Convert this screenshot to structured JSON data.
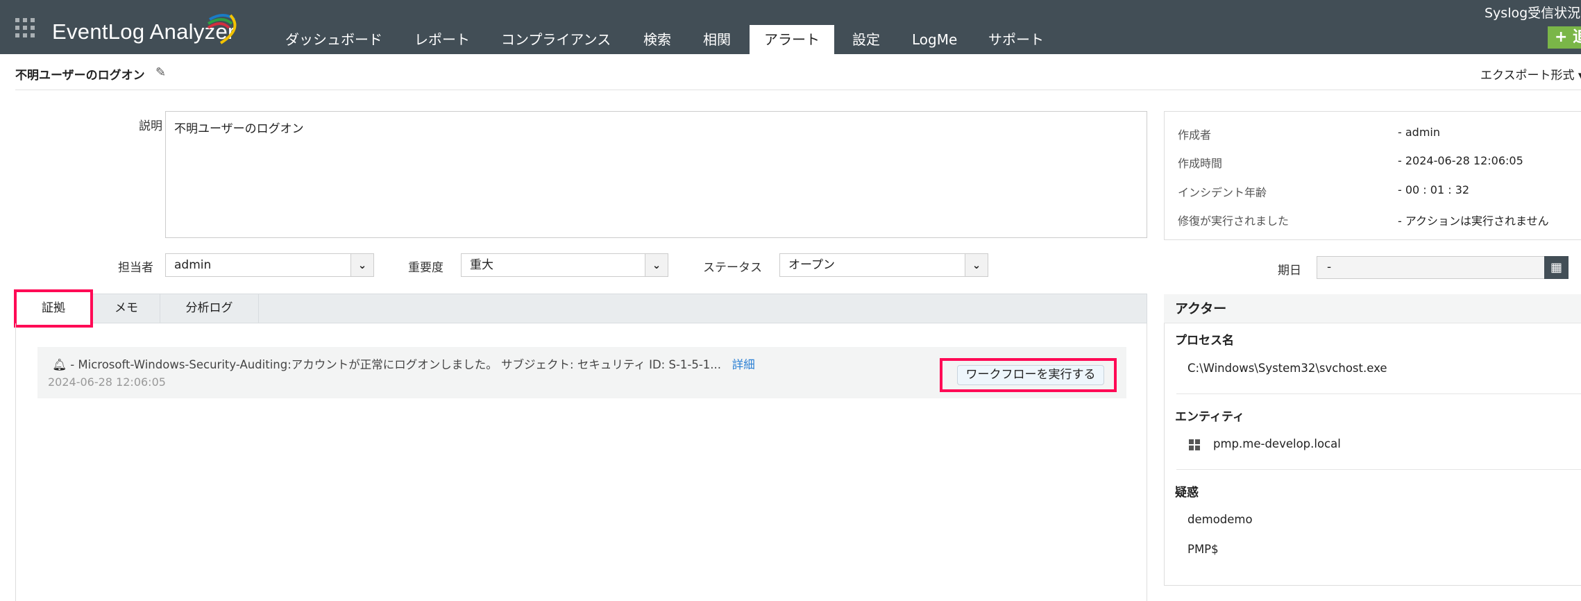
{
  "header": {
    "app_name": "EventLog Analyzer",
    "nav": [
      "ダッシュボード",
      "レポート",
      "コンプライアンス",
      "検索",
      "相関",
      "アラート",
      "設定",
      "LogMe",
      "サポート"
    ],
    "active_nav": "アラート",
    "syslog_status": "Syslog受信状況",
    "add_button": "+ 追"
  },
  "page": {
    "title": "不明ユーザーのログオン",
    "export": "エクスポート形式 ▾"
  },
  "form": {
    "description_label": "説明",
    "description_value": "不明ユーザーのログオン",
    "assignee_label": "担当者",
    "assignee_value": "admin",
    "severity_label": "重要度",
    "severity_value": "重大",
    "status_label": "ステータス",
    "status_value": "オープン",
    "due_label": "期日",
    "due_value": "-"
  },
  "info": [
    {
      "k": "作成者",
      "v": "-  admin"
    },
    {
      "k": "作成時間",
      "v": "-  2024-06-28 12:06:05"
    },
    {
      "k": "インシデント年齢",
      "v": "-  00 : 01 : 32"
    },
    {
      "k": "修復が実行されました",
      "v": "-  アクションは実行されません"
    }
  ],
  "tabs": [
    "証拠",
    "メモ",
    "分析ログ"
  ],
  "event": {
    "text": "-  Microsoft-Windows-Security-Auditing:アカウントが正常にログオンしました。 サブジェクト: セキュリティ ID: S-1-5-1...",
    "more": "詳細",
    "date": "2024-06-28 12:06:05",
    "workflow_button": "ワークフローを実行する"
  },
  "actor": {
    "title": "アクター",
    "process_label": "プロセス名",
    "process": "C:\\Windows\\System32\\svchost.exe",
    "entity_label": "エンティティ",
    "entity": "pmp.me-develop.local",
    "suspect_label": "疑惑",
    "suspects": [
      "demodemo",
      "PMP$"
    ]
  }
}
